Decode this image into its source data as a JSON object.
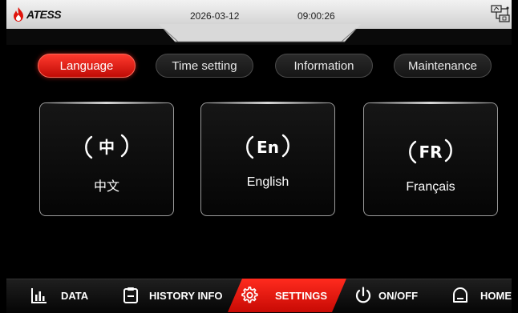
{
  "header": {
    "logo_text": "ATESS",
    "date": "2026-03-12",
    "time": "09:00:26",
    "icons": {
      "logo": "flame-logo-icon",
      "network": "network-status-icon"
    }
  },
  "tabs": [
    {
      "label": "Language",
      "active": true
    },
    {
      "label": "Time setting",
      "active": false
    },
    {
      "label": "Information",
      "active": false
    },
    {
      "label": "Maintenance",
      "active": false
    }
  ],
  "languages": [
    {
      "badge": "中",
      "label": "中文"
    },
    {
      "badge": "En",
      "label": "English"
    },
    {
      "badge": "FR",
      "label": "Français"
    }
  ],
  "nav": [
    {
      "label": "DATA",
      "icon": "bar-chart-icon",
      "active": false
    },
    {
      "label": "HISTORY INFO",
      "icon": "clipboard-icon",
      "active": false
    },
    {
      "label": "SETTINGS",
      "icon": "gear-icon",
      "active": true
    },
    {
      "label": "ON/OFF",
      "icon": "power-icon",
      "active": false
    },
    {
      "label": "HOME",
      "icon": "home-icon",
      "active": false
    }
  ],
  "colors": {
    "accent": "#e0130b",
    "background": "#000000",
    "header": "#e6e6e6"
  }
}
